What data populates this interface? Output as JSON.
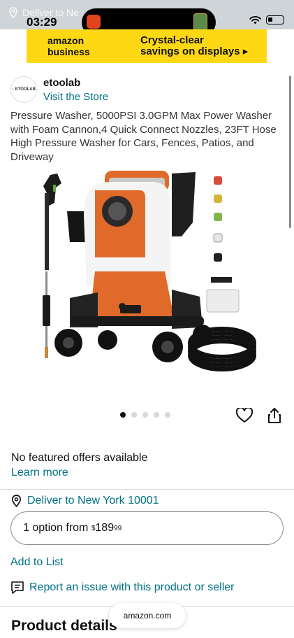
{
  "status_bar": {
    "time": "03:29",
    "ghost_text": "Deliver to Ne"
  },
  "ad": {
    "brand": "amazon business",
    "copy_line1": "Crystal-clear",
    "copy_line2": "savings on displays ▸",
    "color": "#ffd814"
  },
  "seller": {
    "logo_text": "ETOOLAB",
    "name": "etoolab",
    "visit_store": "Visit the Store"
  },
  "product": {
    "title": "Pressure Washer, 5000PSI 3.0GPM Max Power Washer with Foam Cannon,4 Quick Connect Nozzles, 23FT Hose High Pressure Washer for Cars, Fences, Patios, and Driveway",
    "image_alt": "pressure-washer-product-image",
    "carousel_count": 5,
    "carousel_active": 0
  },
  "offers": {
    "no_offers": "No featured offers available",
    "learn_more": "Learn more"
  },
  "delivery": {
    "text": "Deliver to New York 10001"
  },
  "option": {
    "prefix": "1 option from ",
    "currency": "$",
    "whole": "189",
    "fraction": "99"
  },
  "actions": {
    "add_to_list": "Add to List",
    "report": "Report an issue with this product or seller"
  },
  "details": {
    "heading": "Product details"
  },
  "browser": {
    "url": "amazon.com"
  },
  "colors": {
    "link": "#007185",
    "text": "#0f1111"
  }
}
